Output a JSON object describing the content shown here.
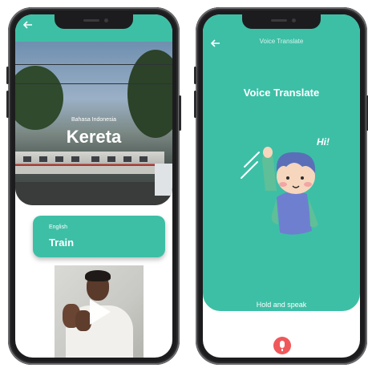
{
  "colors": {
    "accent": "#3dbfa6",
    "mic": "#f0585a",
    "phone": "#1c1c1e"
  },
  "left_screen": {
    "back_icon": "arrow-left-icon",
    "source": {
      "language": "Bahasa Indonesia",
      "word": "Kereta"
    },
    "result": {
      "language": "English",
      "word": "Train"
    },
    "video": {
      "play_icon": "play-icon"
    }
  },
  "right_screen": {
    "back_icon": "arrow-left-icon",
    "header_title": "Voice Translate",
    "title": "Voice Translate",
    "illustration_text": "Hi!",
    "hint": "Hold and speak",
    "mic_icon": "microphone-icon"
  }
}
